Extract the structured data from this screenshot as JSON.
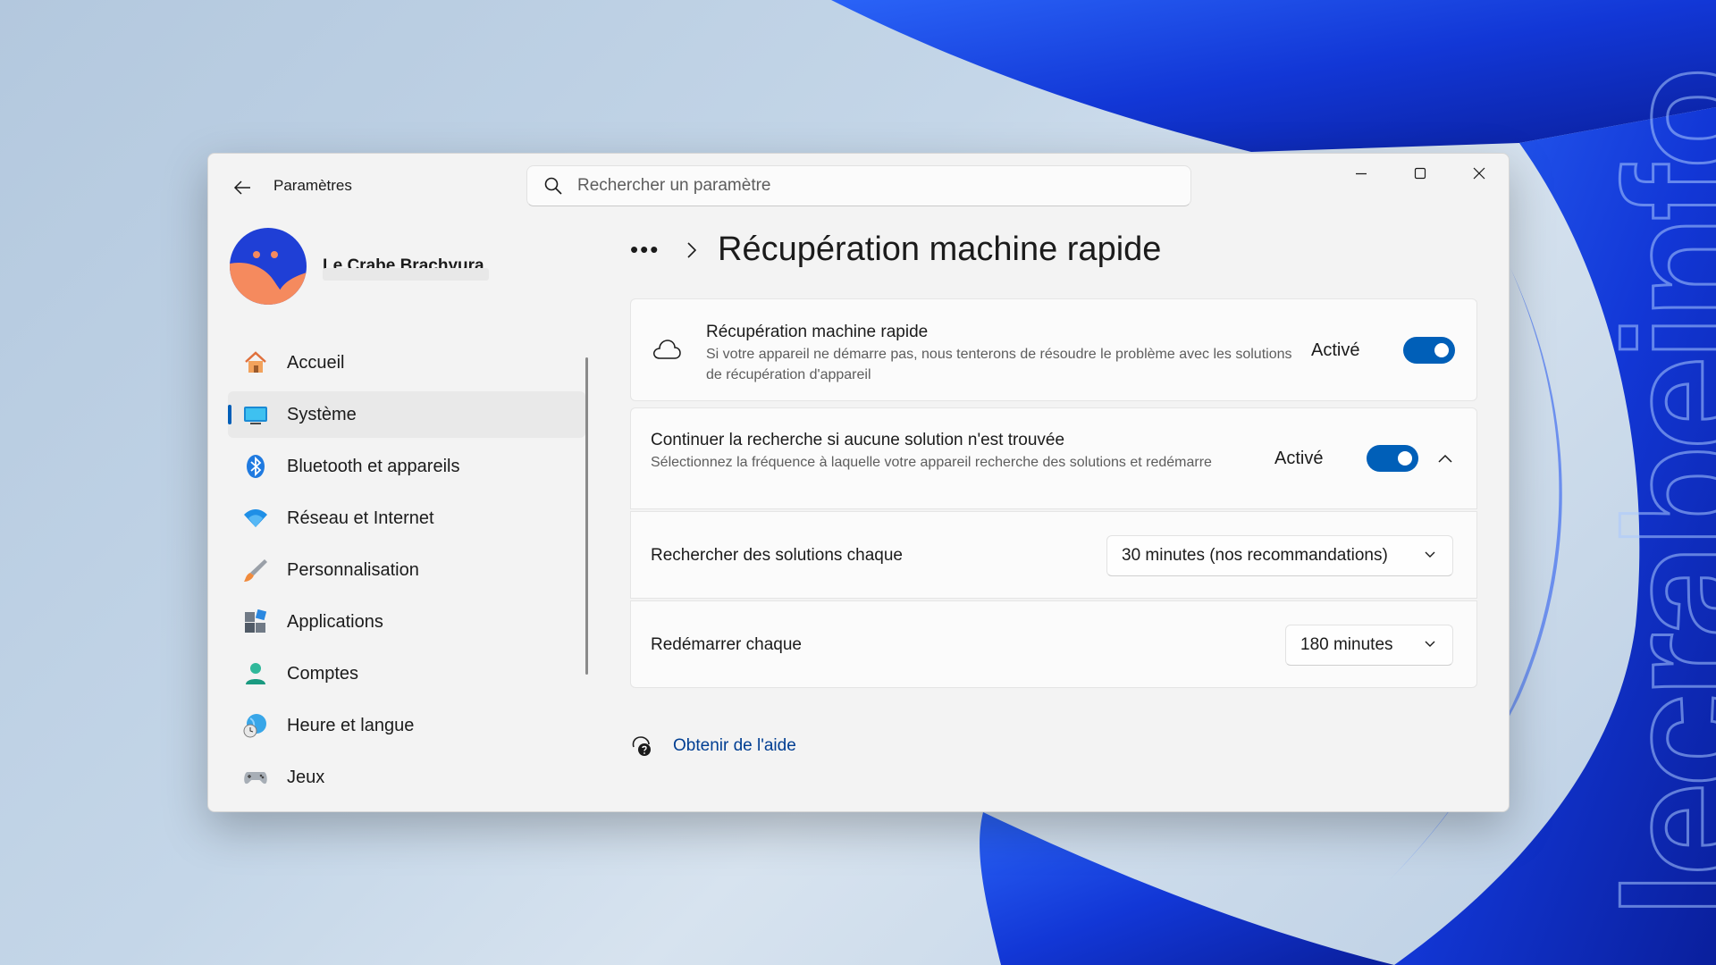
{
  "titlebar": {
    "app_title": "Paramètres",
    "search_placeholder": "Rechercher un paramètre"
  },
  "profile": {
    "name": "Le Crabe Brachyura"
  },
  "sidebar": {
    "items": [
      {
        "label": "Accueil",
        "icon": "home-icon"
      },
      {
        "label": "Système",
        "icon": "system-icon",
        "active": true
      },
      {
        "label": "Bluetooth et appareils",
        "icon": "bluetooth-icon"
      },
      {
        "label": "Réseau et Internet",
        "icon": "wifi-icon"
      },
      {
        "label": "Personnalisation",
        "icon": "brush-icon"
      },
      {
        "label": "Applications",
        "icon": "apps-icon"
      },
      {
        "label": "Comptes",
        "icon": "accounts-icon"
      },
      {
        "label": "Heure et langue",
        "icon": "time-language-icon"
      },
      {
        "label": "Jeux",
        "icon": "gaming-icon"
      }
    ]
  },
  "main": {
    "breadcrumb_more": "•••",
    "page_title": "Récupération machine rapide",
    "quick_recovery": {
      "title": "Récupération machine rapide",
      "description": "Si votre appareil ne démarre pas, nous tenterons de résoudre le problème avec les solutions de récupération d'appareil",
      "state": "Activé"
    },
    "continue_search": {
      "title": "Continuer la recherche si aucune solution n'est trouvée",
      "description": "Sélectionnez la fréquence à laquelle votre appareil recherche des solutions et redémarre",
      "state": "Activé"
    },
    "search_interval": {
      "label": "Rechercher des solutions chaque",
      "value": "30 minutes (nos recommandations)"
    },
    "restart_interval": {
      "label": "Redémarrer chaque",
      "value": "180 minutes"
    },
    "help_link": "Obtenir de l'aide"
  },
  "watermark": "lecrabeinfo",
  "colors": {
    "accent": "#005fb8",
    "link": "#003e92",
    "wallpaper_blue": "#1a47e6"
  }
}
